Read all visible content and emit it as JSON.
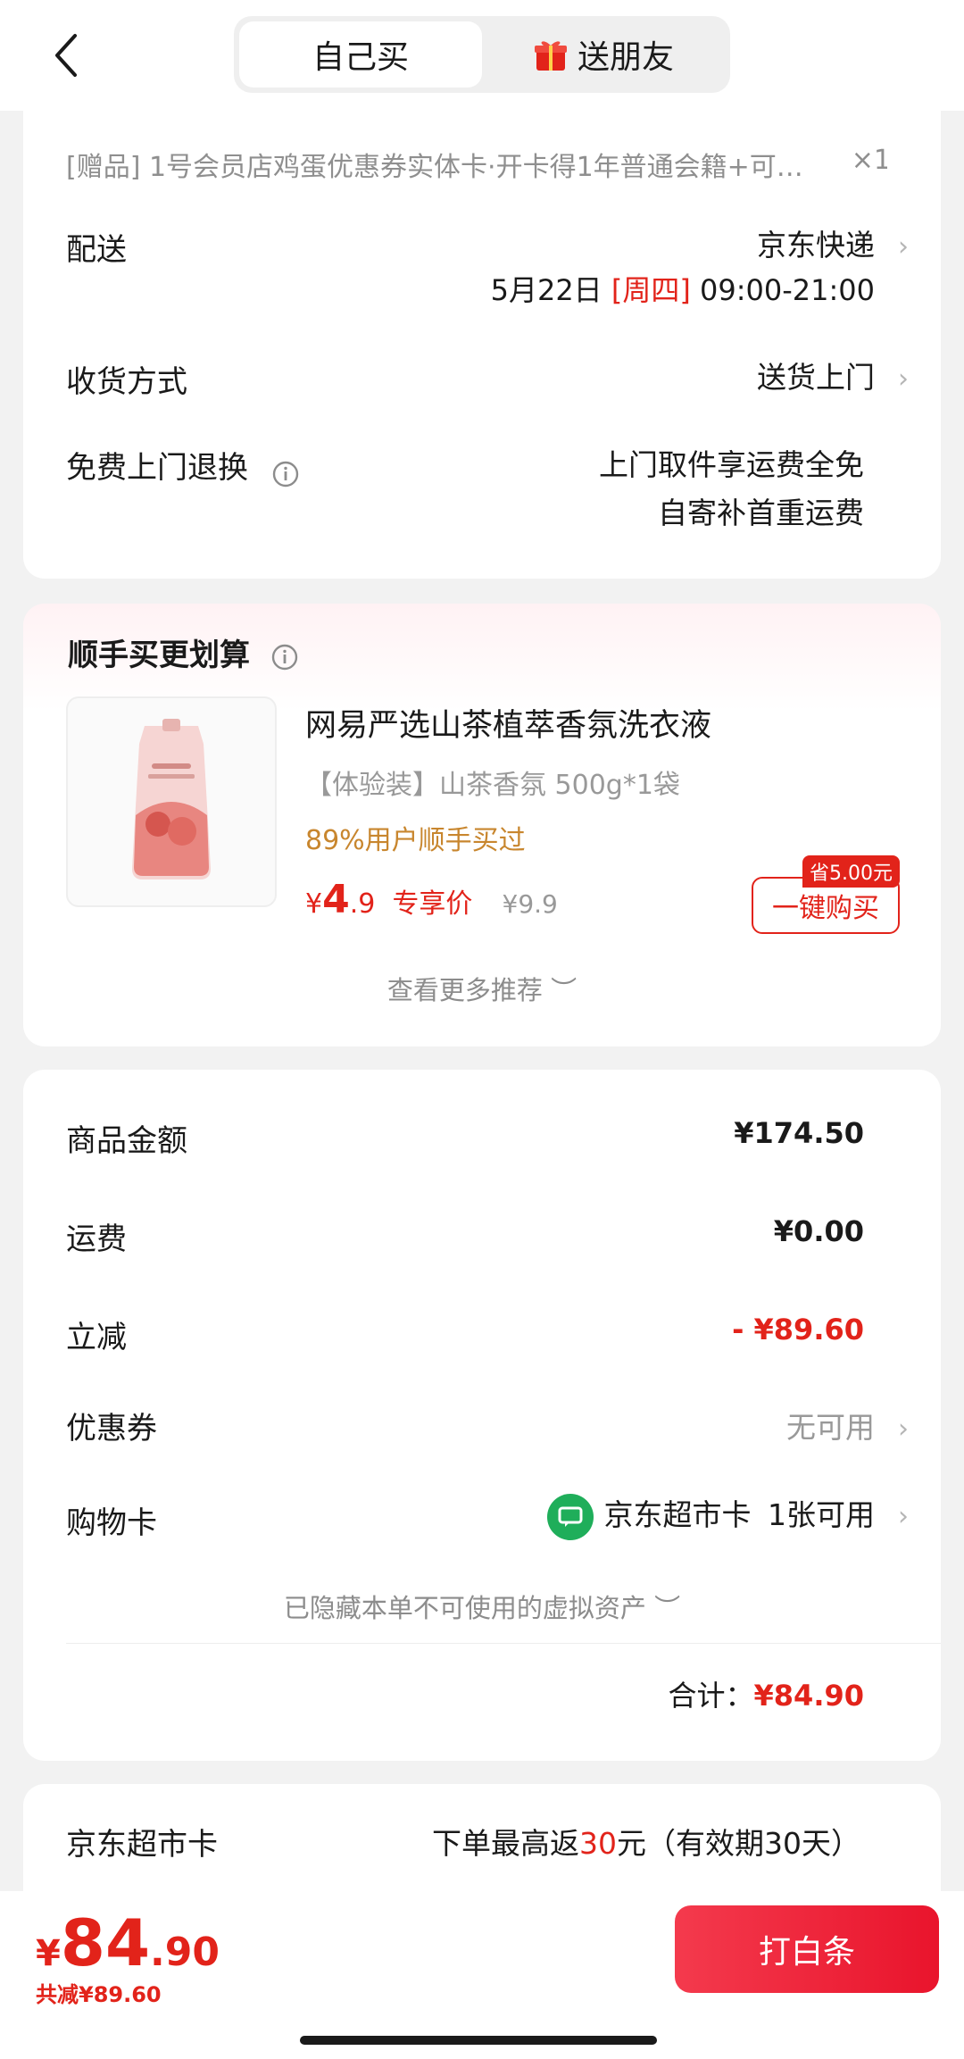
{
  "header": {
    "tab_self": "自己买",
    "tab_gift": "送朋友"
  },
  "order_info": {
    "gift_item": "[赠品]  1号会员店鸡蛋优惠券实体卡·开卡得1年普通会籍+可…",
    "gift_qty": "×1",
    "delivery_label": "配送",
    "delivery_value": "京东快递",
    "delivery_date": "5月22日",
    "delivery_weekday": "[周四]",
    "delivery_time": "09:00-21:00",
    "receive_label": "收货方式",
    "receive_value": "送货上门",
    "return_label": "免费上门退换",
    "return_line1": "上门取件享运费全免",
    "return_line2": "自寄补首重运费"
  },
  "recommend": {
    "title": "顺手买更划算",
    "product_name": "网易严选山茶植萃香氛洗衣液",
    "product_spec": "【体验装】山茶香氛 500g*1袋",
    "product_hint": "89%用户顺手买过",
    "price_currency": "¥",
    "price_int": "4",
    "price_dec": ".9",
    "price_tag": "专享价",
    "price_old": "¥9.9",
    "save_badge": "省5.00元",
    "buy_button": "一键购买",
    "more_link": "查看更多推荐 ︶"
  },
  "summary": {
    "goods_label": "商品金额",
    "goods_value": "¥174.50",
    "shipping_label": "运费",
    "shipping_value": "¥0.00",
    "discount_label": "立减",
    "discount_value": "- ¥89.60",
    "coupon_label": "优惠券",
    "coupon_value": "无可用",
    "card_label": "购物卡",
    "card_name": "京东超市卡",
    "card_value": "1张可用",
    "hidden_assets": "已隐藏本单不可使用的虚拟资产 ︶",
    "total_label": "合计：",
    "total_value": "¥84.90"
  },
  "cashback": {
    "label": "京东超市卡",
    "prefix": "下单最高返",
    "amount": "30",
    "suffix": "元（有效期30天）"
  },
  "bottom_bar": {
    "currency": "¥",
    "price_int": "84",
    "price_dec": ".90",
    "total_saved": "共减¥89.60",
    "pay_button": "打白条"
  },
  "colors": {
    "accent_red": "#e2231a",
    "hint_orange": "#c8862e",
    "jd_green": "#1fae5a"
  }
}
